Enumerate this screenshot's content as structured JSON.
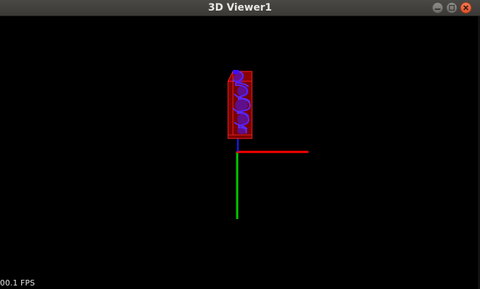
{
  "window": {
    "title": "3D Viewer1",
    "buttons": {
      "minimize": "minimize-icon",
      "maximize": "maximize-icon",
      "close": "close-icon"
    }
  },
  "viewport": {
    "fps_label": "00.1 FPS",
    "background": "#000000",
    "axes": {
      "x_color": "#ff0000",
      "y_color": "#00cc00",
      "z_color": "#1a1aff"
    },
    "model": {
      "box_color": "#cc0000",
      "mesh_color": "#4a1aff"
    }
  }
}
